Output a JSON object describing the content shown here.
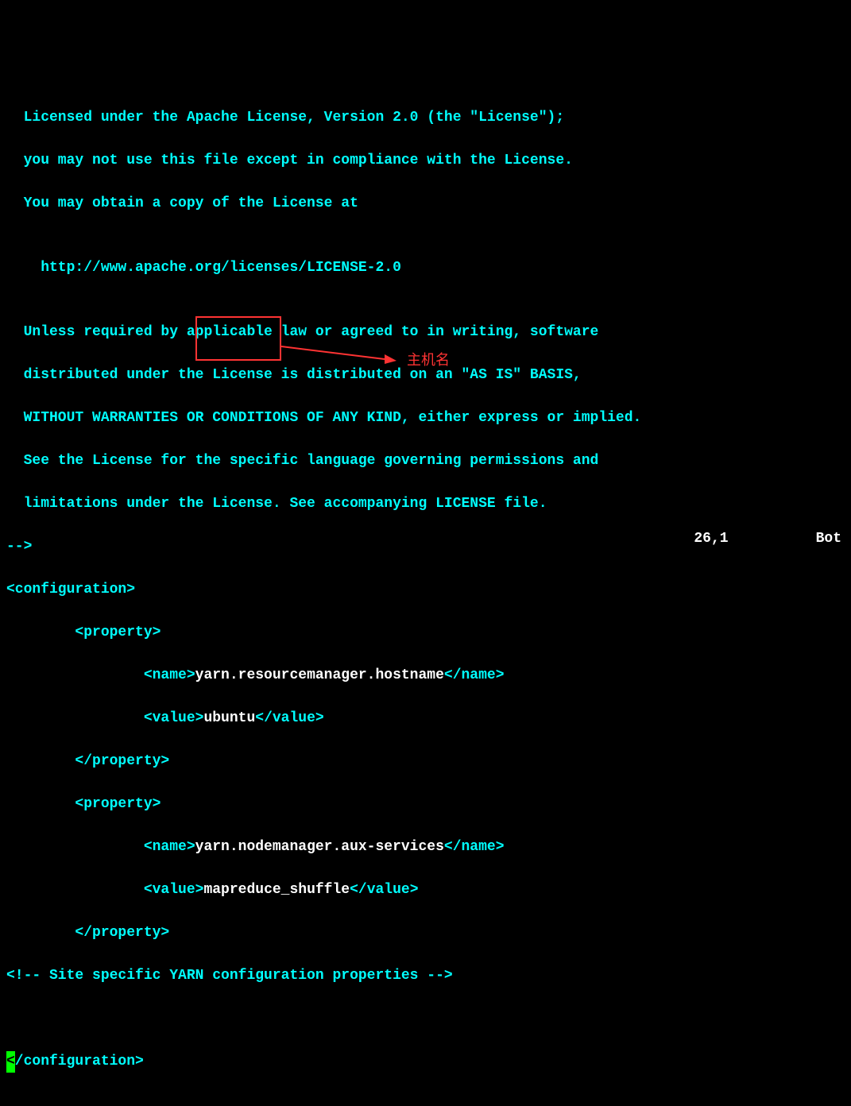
{
  "license": {
    "l1": "  Licensed under the Apache License, Version 2.0 (the \"License\");",
    "l2": "  you may not use this file except in compliance with the License.",
    "l3": "  You may obtain a copy of the License at",
    "l4": "",
    "l5": "    http://www.apache.org/licenses/LICENSE-2.0",
    "l6": "",
    "l7": "  Unless required by applicable law or agreed to in writing, software",
    "l8": "  distributed under the License is distributed on an \"AS IS\" BASIS,",
    "l9": "  WITHOUT WARRANTIES OR CONDITIONS OF ANY KIND, either express or implied.",
    "l10": "  See the License for the specific language governing permissions and",
    "l11": "  limitations under the License. See accompanying LICENSE file.",
    "l12": "-->"
  },
  "xml": {
    "config_open": "<configuration>",
    "prop_open": "        <property>",
    "name1_open": "                <name>",
    "name1_val": "yarn.resourcemanager.hostname",
    "name1_close": "</name>",
    "value1_open": "                <value>",
    "value1_val": "ubuntu",
    "value1_close": "</value>",
    "prop_close": "        </property>",
    "name2_open": "                <name>",
    "name2_val": "yarn.nodemanager.aux-services",
    "name2_close": "</name>",
    "value2_open": "                <value>",
    "value2_val": "mapreduce_shuffle",
    "value2_close": "</value>",
    "comment": "<!-- Site specific YARN configuration properties -->",
    "config_close_rest": "/configuration>"
  },
  "annotation": {
    "label": "主机名"
  },
  "status": {
    "position": "26,1",
    "scroll": "Bot"
  },
  "cursor": {
    "char": "<"
  }
}
